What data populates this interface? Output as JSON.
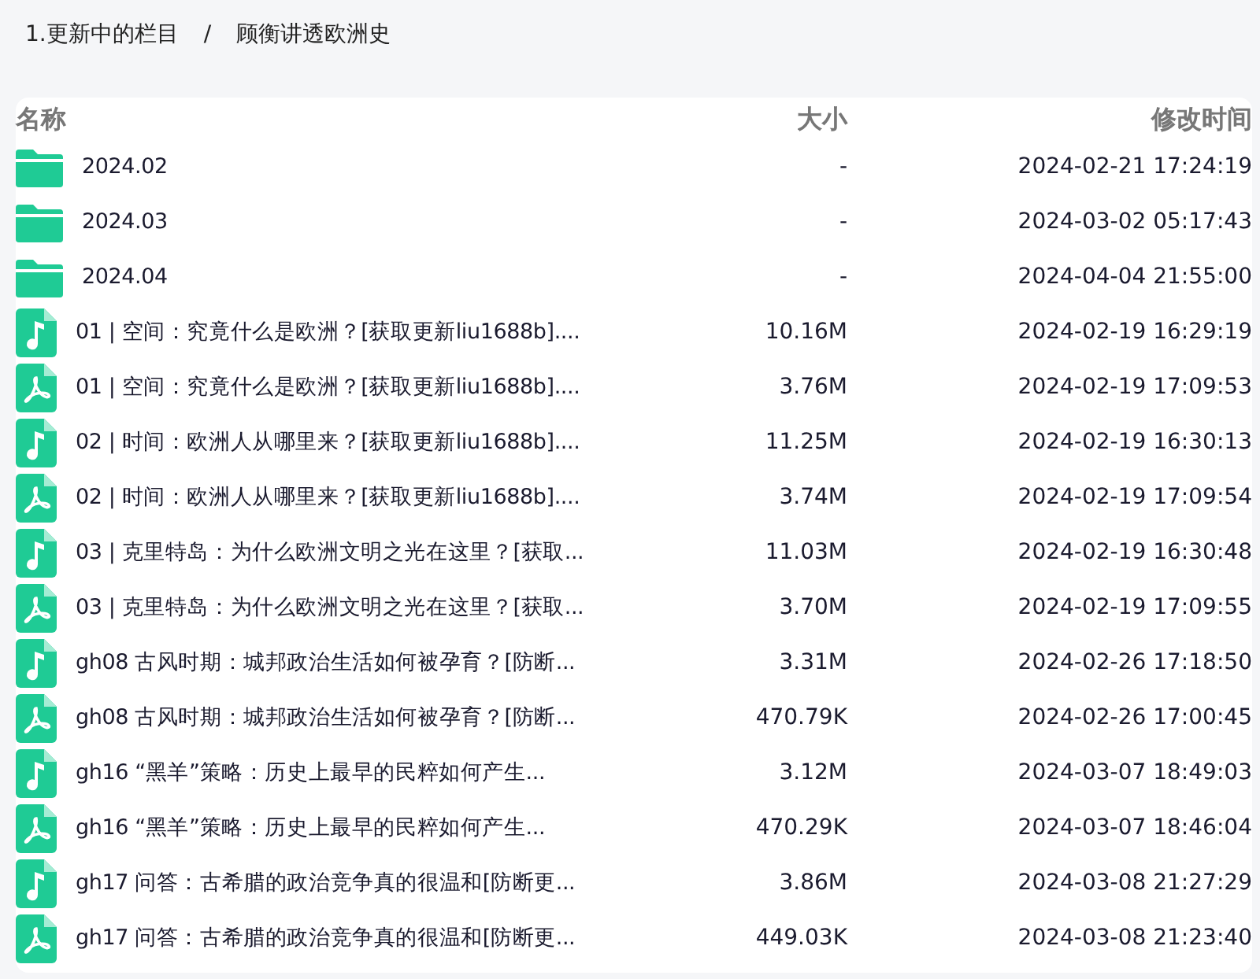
{
  "breadcrumb": [
    {
      "label": "1.更新中的栏目"
    },
    {
      "label": "/"
    },
    {
      "label": "顾衡讲透欧洲史"
    }
  ],
  "table": {
    "columns": [
      "名称",
      "大小",
      "修改时间"
    ],
    "rows": [
      {
        "kind": "folder",
        "name": "2024.02",
        "size": "-",
        "modified": "2024-02-21 17:24:19"
      },
      {
        "kind": "folder",
        "name": "2024.03",
        "size": "-",
        "modified": "2024-03-02 05:17:43"
      },
      {
        "kind": "folder",
        "name": "2024.04",
        "size": "-",
        "modified": "2024-04-04 21:55:00"
      },
      {
        "kind": "audio",
        "name": "01 | 空间：究竟什么是欧洲？[获取更新liu1688b]....",
        "size": "10.16M",
        "modified": "2024-02-19 16:29:19"
      },
      {
        "kind": "pdf",
        "name": "01 | 空间：究竟什么是欧洲？[获取更新liu1688b]....",
        "size": "3.76M",
        "modified": "2024-02-19 17:09:53"
      },
      {
        "kind": "audio",
        "name": "02 | 时间：欧洲人从哪里来？[获取更新liu1688b]....",
        "size": "11.25M",
        "modified": "2024-02-19 16:30:13"
      },
      {
        "kind": "pdf",
        "name": "02 | 时间：欧洲人从哪里来？[获取更新liu1688b]....",
        "size": "3.74M",
        "modified": "2024-02-19 17:09:54"
      },
      {
        "kind": "audio",
        "name": "03 | 克里特岛：为什么欧洲文明之光在这里？[获取...",
        "size": "11.03M",
        "modified": "2024-02-19 16:30:48"
      },
      {
        "kind": "pdf",
        "name": "03 | 克里特岛：为什么欧洲文明之光在这里？[获取...",
        "size": "3.70M",
        "modified": "2024-02-19 17:09:55"
      },
      {
        "kind": "audio",
        "name": "gh08 古风时期：城邦政治生活如何被孕育？[防断...",
        "size": "3.31M",
        "modified": "2024-02-26 17:18:50"
      },
      {
        "kind": "pdf",
        "name": "gh08 古风时期：城邦政治生活如何被孕育？[防断...",
        "size": "470.79K",
        "modified": "2024-02-26 17:00:45"
      },
      {
        "kind": "audio",
        "name": "gh16 “黑羊”策略：历史上最早的民粹如何产生...",
        "size": "3.12M",
        "modified": "2024-03-07 18:49:03"
      },
      {
        "kind": "pdf",
        "name": "gh16 “黑羊”策略：历史上最早的民粹如何产生...",
        "size": "470.29K",
        "modified": "2024-03-07 18:46:04"
      },
      {
        "kind": "audio",
        "name": "gh17 问答：古希腊的政治竞争真的很温和[防断更...",
        "size": "3.86M",
        "modified": "2024-03-08 21:27:29"
      },
      {
        "kind": "pdf",
        "name": "gh17 问答：古希腊的政治竞争真的很温和[防断更...",
        "size": "449.03K",
        "modified": "2024-03-08 21:23:40"
      }
    ]
  }
}
